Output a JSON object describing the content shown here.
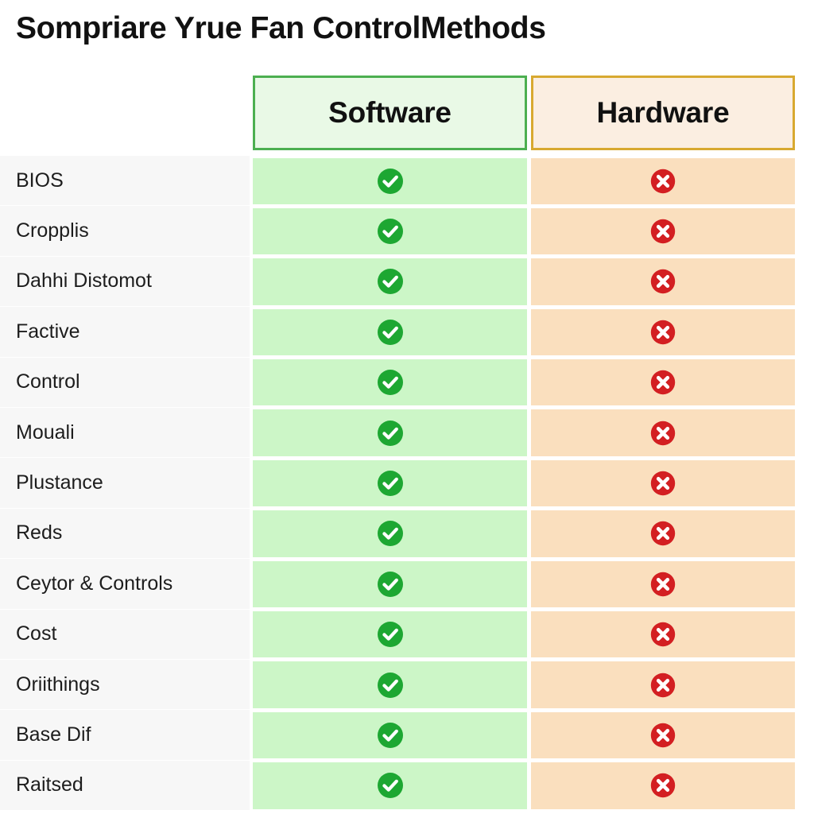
{
  "title": "Sompriare Yrue Fan ControlMethods",
  "colors": {
    "software_header_border": "#4caf50",
    "software_header_fill": "#e9f9e6",
    "hardware_header_border": "#d8a930",
    "hardware_header_fill": "#fbeee1",
    "software_cell_fill": "#ccf6c7",
    "hardware_cell_fill": "#fadfbe",
    "label_cell_fill": "#f7f7f7",
    "check_green": "#1da732",
    "cross_red": "#d31f22",
    "page_background": "#ffffff"
  },
  "columns": [
    {
      "key": "feature",
      "label": ""
    },
    {
      "key": "software",
      "label": "Software"
    },
    {
      "key": "hardware",
      "label": "Hardware"
    }
  ],
  "icons": {
    "supported": "check-circle-icon",
    "unsupported": "cross-circle-icon"
  },
  "rows": [
    {
      "feature": "BIOS",
      "software": "check",
      "hardware": "cross"
    },
    {
      "feature": "Cropplis",
      "software": "check",
      "hardware": "cross"
    },
    {
      "feature": "Dahhi Distomot",
      "software": "check",
      "hardware": "cross"
    },
    {
      "feature": "Factive",
      "software": "check",
      "hardware": "cross"
    },
    {
      "feature": "Control",
      "software": "check",
      "hardware": "cross"
    },
    {
      "feature": "Mouali",
      "software": "check",
      "hardware": "cross"
    },
    {
      "feature": "Plustance",
      "software": "check",
      "hardware": "cross"
    },
    {
      "feature": "Reds",
      "software": "check",
      "hardware": "cross"
    },
    {
      "feature": "Ceytor & Controls",
      "software": "check",
      "hardware": "cross"
    },
    {
      "feature": "Cost",
      "software": "check",
      "hardware": "cross"
    },
    {
      "feature": "Oriithings",
      "software": "check",
      "hardware": "cross"
    },
    {
      "feature": "Base Dif",
      "software": "check",
      "hardware": "cross"
    },
    {
      "feature": "Raitsed",
      "software": "check",
      "hardware": "cross"
    }
  ]
}
